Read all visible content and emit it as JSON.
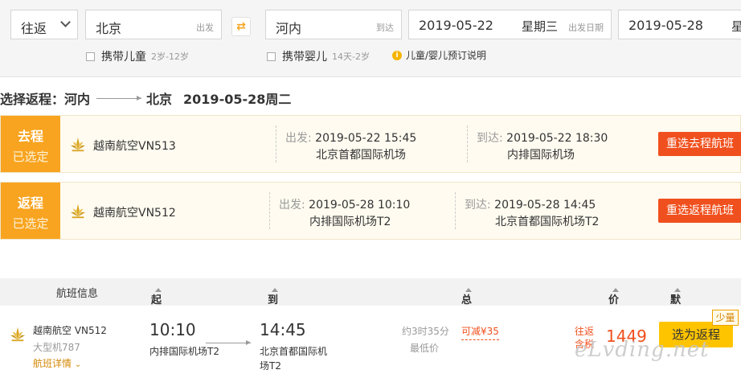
{
  "search": {
    "trip_type": "往返",
    "from_city": "北京",
    "from_suffix": "出发",
    "to_city": "河内",
    "to_suffix": "到达",
    "depart_date": "2019-05-22",
    "depart_weekday": "星期三",
    "depart_suffix": "出发日期",
    "return_date": "2019-05-28",
    "return_weekday_partial": "星",
    "child_label": "携带儿童",
    "child_age": "2岁-12岁",
    "infant_label": "携带婴儿",
    "infant_age": "14天-2岁",
    "info_text": "儿童/婴儿预订说明",
    "info_icon": "i"
  },
  "page_title": {
    "prefix": "选择返程：河内",
    "dest": "北京",
    "date": "2019-05-28周二"
  },
  "outbound": {
    "tag_title": "去程",
    "tag_status": "已选定",
    "airline_flight": "越南航空VN513",
    "depart_label": "出发: ",
    "depart_time": "2019-05-22 15:45",
    "depart_airport": "北京首都国际机场",
    "arrive_label": "到达: ",
    "arrive_time": "2019-05-22 18:30",
    "arrive_airport": "内排国际机场",
    "button": "重选去程航班"
  },
  "return": {
    "tag_title": "返程",
    "tag_status": "已选定",
    "airline_flight": "越南航空VN512",
    "depart_label": "出发: ",
    "depart_time": "2019-05-28 10:10",
    "depart_airport": "内排国际机场T2",
    "arrive_label": "到达: ",
    "arrive_time": "2019-05-28 14:45",
    "arrive_airport": "北京首都国际机场T2",
    "button": "重选返程航班"
  },
  "list_header": {
    "flight_info": "航班信息",
    "depart_time": "起飞时间",
    "arrive_time": "到达时间",
    "duration": "总耗时",
    "price": "价格",
    "sort": "默认排序"
  },
  "flight": {
    "airline": "越南航空",
    "flight_no": "VN512",
    "aircraft": "大型机787",
    "details": "航班详情",
    "dep_time": "10:10",
    "dep_airport": "内排国际机场T2",
    "arr_time": "14:45",
    "arr_airport_line1": "北京首都国际机",
    "arr_airport_line2": "场T2",
    "duration": "约3时35分",
    "lowest": "最低价",
    "discount": "可减¥35",
    "price_note1": "往返",
    "price_note2": "含税",
    "price": "1449",
    "select_button": "选为返程",
    "badge": "少量"
  },
  "watermark": "eLvding.net",
  "colors": {
    "accent_orange": "#f8a420",
    "button_red": "#f0501e",
    "price_red": "#f0501e",
    "select_yellow": "#ffc400"
  }
}
